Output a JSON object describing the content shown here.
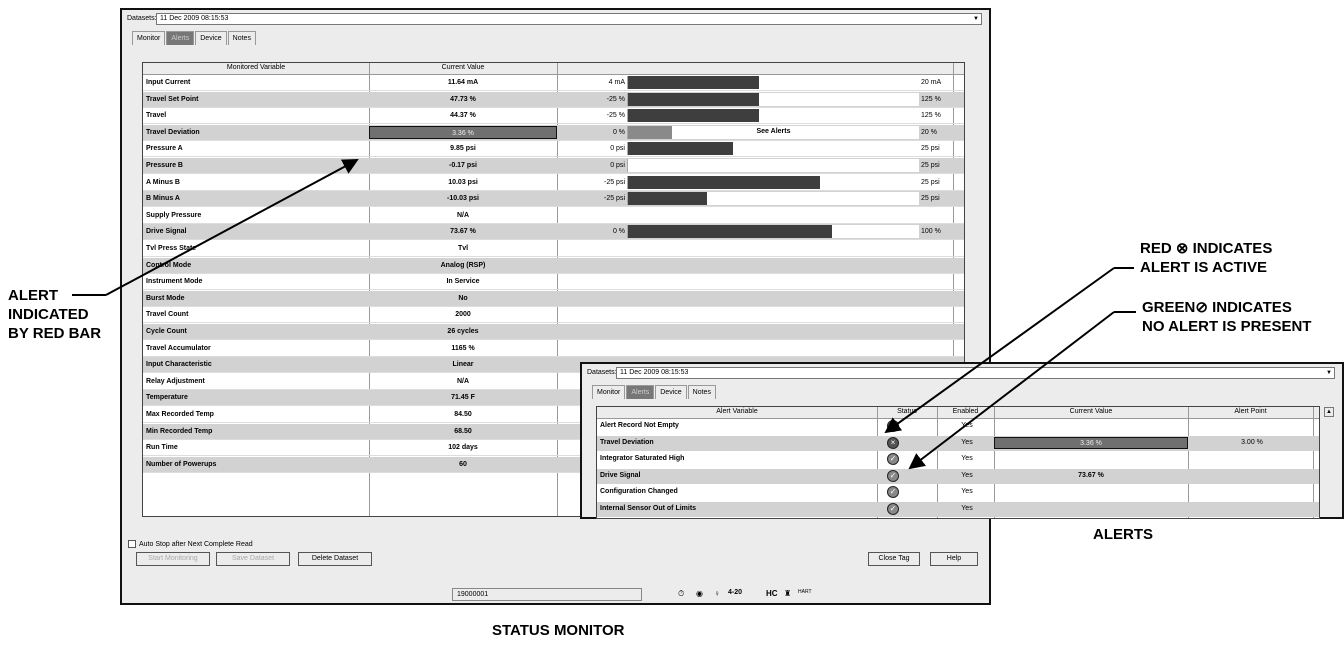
{
  "main": {
    "datasets_label": "Datasets:",
    "dataset_value": "11 Dec 2009 08:15:53",
    "tabs": [
      "Monitor",
      "Alerts",
      "Device",
      "Notes"
    ],
    "columns": [
      "Monitored Variable",
      "Current Value"
    ],
    "rows": [
      {
        "name": "Input Current",
        "value": "11.64 mA",
        "lo": "4 mA",
        "hi": "20 mA",
        "fill": 0.45
      },
      {
        "name": "Travel Set Point",
        "value": "47.73 %",
        "lo": "-25 %",
        "hi": "125 %",
        "fill": 0.45
      },
      {
        "name": "Travel",
        "value": "44.37 %",
        "lo": "-25 %",
        "hi": "125 %",
        "fill": 0.45
      },
      {
        "name": "Travel Deviation",
        "value": "3.36 %",
        "lo": "0 %",
        "hi": "20 %",
        "fill": 0.15,
        "alert": true,
        "bar_label": "See Alerts"
      },
      {
        "name": "Pressure A",
        "value": "9.85 psi",
        "lo": "0 psi",
        "hi": "25 psi",
        "fill": 0.36
      },
      {
        "name": "Pressure B",
        "value": "-0.17 psi",
        "lo": "0 psi",
        "hi": "25 psi",
        "fill": 0
      },
      {
        "name": "A Minus B",
        "value": "10.03 psi",
        "lo": "-25 psi",
        "hi": "25 psi",
        "fill": 0.66
      },
      {
        "name": "B Minus A",
        "value": "-10.03 psi",
        "lo": "-25 psi",
        "hi": "25 psi",
        "fill": 0.27
      },
      {
        "name": "Supply Pressure",
        "value": "N/A"
      },
      {
        "name": "Drive Signal",
        "value": "73.67 %",
        "lo": "0 %",
        "hi": "100 %",
        "fill": 0.7
      },
      {
        "name": "Tvl Press State",
        "value": "Tvl"
      },
      {
        "name": "Control Mode",
        "value": "Analog (RSP)"
      },
      {
        "name": "Instrument Mode",
        "value": "In Service"
      },
      {
        "name": "Burst Mode",
        "value": "No"
      },
      {
        "name": "Travel Count",
        "value": "2000"
      },
      {
        "name": "Cycle Count",
        "value": "26 cycles"
      },
      {
        "name": "Travel Accumulator",
        "value": "1165 %"
      },
      {
        "name": "Input Characteristic",
        "value": "Linear"
      },
      {
        "name": "Relay Adjustment",
        "value": "N/A"
      },
      {
        "name": "Temperature",
        "value": "71.45 F"
      },
      {
        "name": "Max Recorded Temp",
        "value": "84.50"
      },
      {
        "name": "Min Recorded Temp",
        "value": "68.50"
      },
      {
        "name": "Run Time",
        "value": "102 days"
      },
      {
        "name": "Number of Powerups",
        "value": "60"
      }
    ],
    "auto_stop_label": "Auto Stop after Next Complete Read",
    "buttons": {
      "start": "Start Monitoring",
      "save": "Save Dataset",
      "delete": "Delete Dataset",
      "close": "Close Tag",
      "help": "Help"
    },
    "status_id": "19000001",
    "status_text": "4-20",
    "status_hc": "HC",
    "status_hart": "HART"
  },
  "alerts_window": {
    "datasets_label": "Datasets:",
    "dataset_value": "11 Dec 2009 08:15:53",
    "tabs": [
      "Monitor",
      "Alerts",
      "Device",
      "Notes"
    ],
    "columns": [
      "Alert Variable",
      "Status",
      "Enabled",
      "Current Value",
      "Alert Point"
    ],
    "rows": [
      {
        "name": "Alert Record Not Empty",
        "status": "red",
        "enabled": "Yes",
        "current": "",
        "point": ""
      },
      {
        "name": "Travel Deviation",
        "status": "red",
        "enabled": "Yes",
        "current": "3.36 %",
        "point": "3.00 %",
        "alert": true
      },
      {
        "name": "Integrator Saturated High",
        "status": "green",
        "enabled": "Yes",
        "current": "",
        "point": ""
      },
      {
        "name": "Drive Signal",
        "status": "green",
        "enabled": "Yes",
        "current": "73.67 %",
        "point": ""
      },
      {
        "name": "Configuration Changed",
        "status": "green",
        "enabled": "Yes",
        "current": "",
        "point": ""
      },
      {
        "name": "Internal Sensor Out of Limits",
        "status": "green",
        "enabled": "Yes",
        "current": "",
        "point": ""
      }
    ]
  },
  "callouts": {
    "alert_bar": [
      "ALERT",
      "INDICATED",
      "BY RED BAR"
    ],
    "red_prefix": "RED",
    "red_line1": "INDICATES",
    "red_line2": "ALERT IS ACTIVE",
    "green_prefix": "GREEN",
    "green_line1": "INDICATES",
    "green_line2": "NO ALERT IS PRESENT",
    "alerts_caption": "ALERTS",
    "status_caption": "STATUS MONITOR"
  }
}
